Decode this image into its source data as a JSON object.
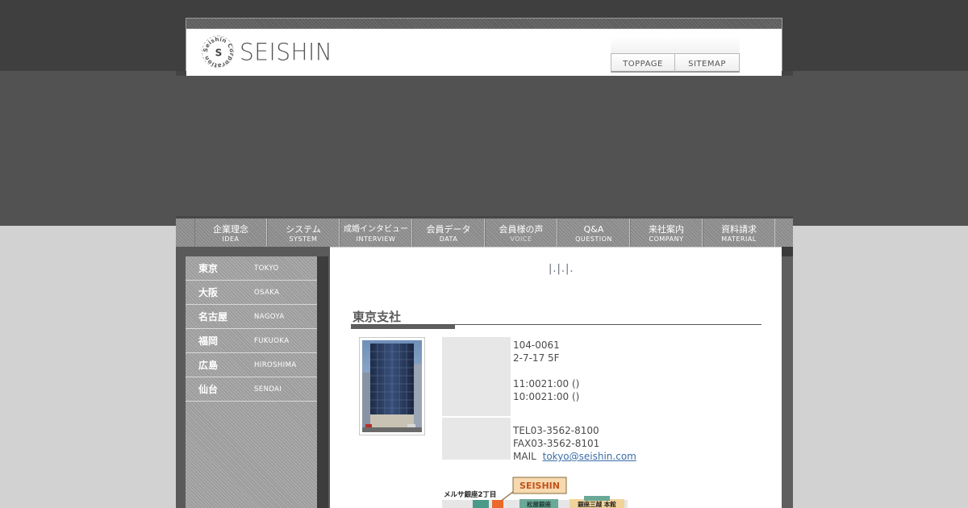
{
  "header": {
    "logo_text": "SEISHIN",
    "logo_ring_text": "Seishin Corporation",
    "logo_letter": "S",
    "topnav": [
      {
        "label": "TOPPAGE"
      },
      {
        "label": "SITEMAP"
      }
    ]
  },
  "mainnav": [
    {
      "jp": "企業理念",
      "en": "IDEA"
    },
    {
      "jp": "システム",
      "en": "SYSTEM"
    },
    {
      "jp": "成婚インタビュー",
      "en": "INTERVIEW"
    },
    {
      "jp": "会員データ",
      "en": "DATA"
    },
    {
      "jp": "会員様の声",
      "en": "VOICE"
    },
    {
      "jp": "Q&A",
      "en": "QUESTION"
    },
    {
      "jp": "来社案内",
      "en": "COMPANY"
    },
    {
      "jp": "資料請求",
      "en": "MATERIAL"
    }
  ],
  "sidebar": [
    {
      "jp": "東京",
      "en": "TOKYO"
    },
    {
      "jp": "大阪",
      "en": "OSAKA"
    },
    {
      "jp": "名古屋",
      "en": "NAGOYA"
    },
    {
      "jp": "福岡",
      "en": "FUKUOKA"
    },
    {
      "jp": "広島",
      "en": "HIROSHIMA"
    },
    {
      "jp": "仙台",
      "en": "SENDAI"
    }
  ],
  "content": {
    "breadcrumb": "|.|.|.",
    "section_title": "東京支社",
    "address": {
      "postal": "104-0061",
      "street": "2-7-17 5F",
      "hours_1": "11:0021:00 ()",
      "hours_2": "10:0021:00 ()"
    },
    "contact": {
      "tel": "TEL03-3562-8100",
      "fax": "FAX03-3562-8101",
      "mail_label": "MAIL",
      "mail": "tokyo@seishin.com"
    },
    "map": {
      "station_label": "メルサ銀座2丁目",
      "brand_label": "SEISHIN",
      "store_1": "松屋銀座",
      "store_2": "銀座三越 本館"
    }
  },
  "colors": {
    "top_band": "#3f3f3f",
    "mid_band": "#525252",
    "page_bg": "#d2d2d2",
    "link": "#3c6ea8",
    "map_accent": "#e8692a",
    "map_teal": "#4a9a8a"
  }
}
